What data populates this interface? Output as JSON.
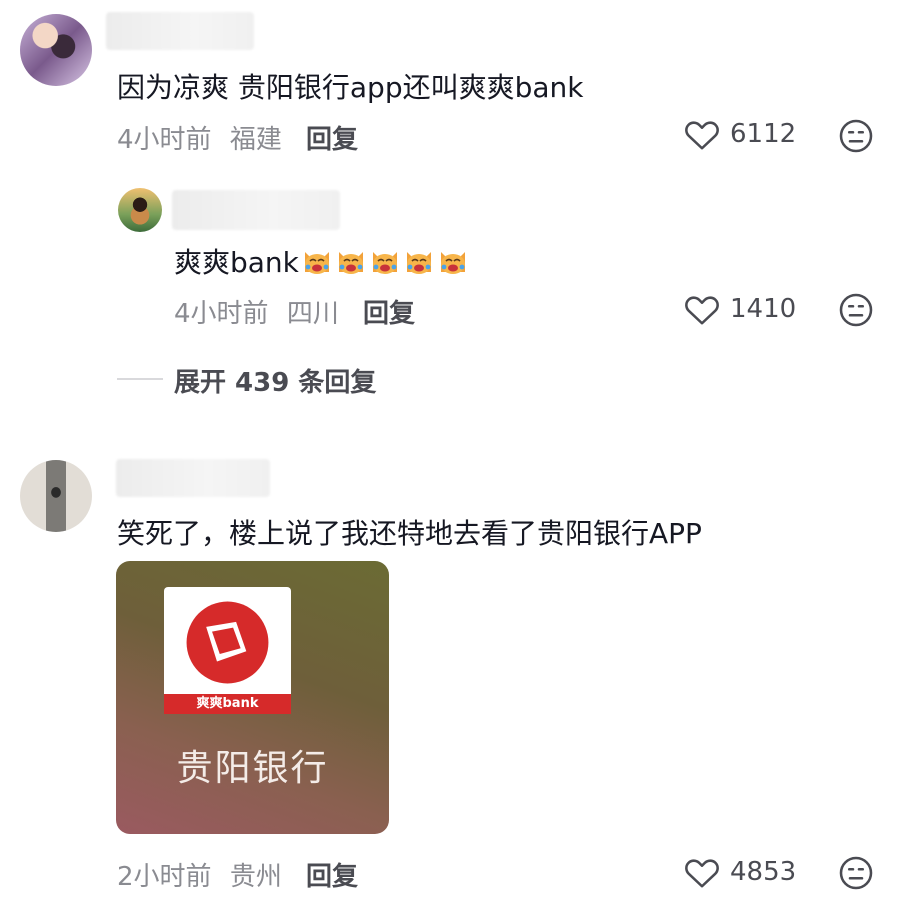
{
  "comment1": {
    "text": "因为凉爽 贵阳银行app还叫爽爽bank",
    "time": "4小时前",
    "location": "福建",
    "reply_label": "回复",
    "likes": "6112"
  },
  "reply1": {
    "text": "爽爽bank",
    "emoji": "crying-laughing-cat-emoji",
    "time": "4小时前",
    "location": "四川",
    "reply_label": "回复",
    "likes": "1410"
  },
  "expand": {
    "label": "展开 439 条回复"
  },
  "comment2": {
    "text": "笑死了，楼上说了我还特地去看了贵阳银行APP",
    "time": "2小时前",
    "location": "贵州",
    "reply_label": "回复",
    "likes": "4853",
    "image": {
      "app_name": "贵阳银行",
      "badge": "爽爽bank",
      "logo_color": "#d62a2a"
    }
  },
  "colors": {
    "text_primary": "#161823",
    "text_meta": "#8a8b91",
    "accent_red": "#d62a2a"
  }
}
